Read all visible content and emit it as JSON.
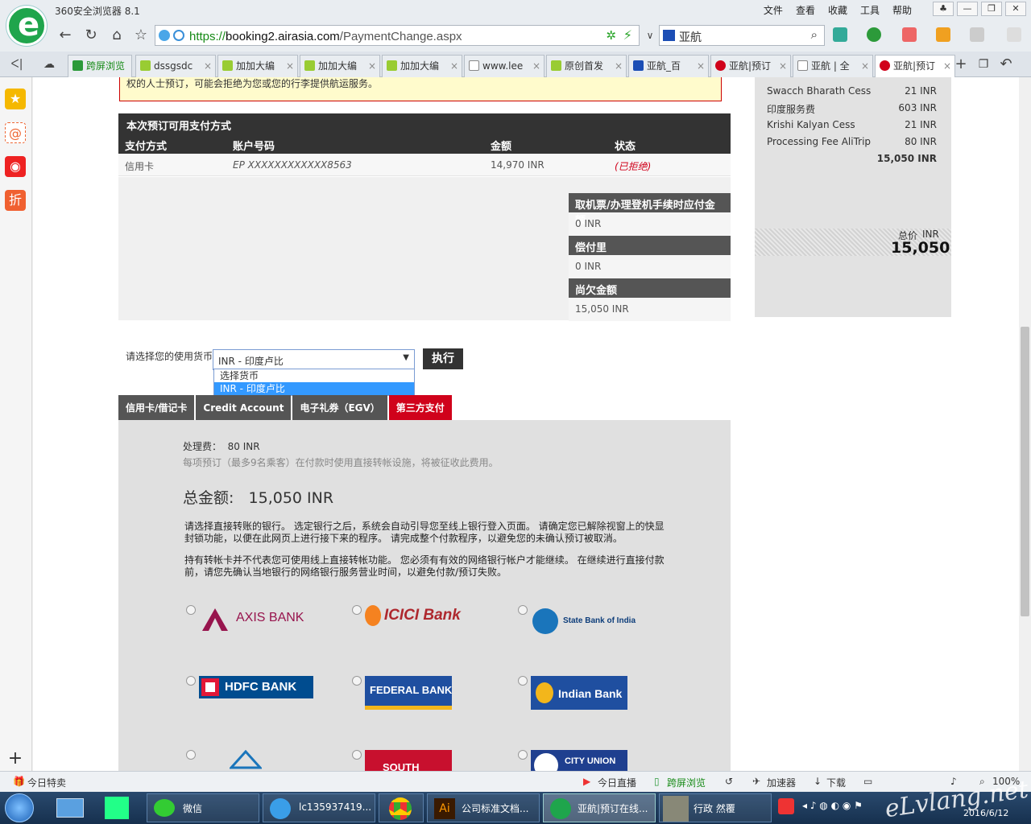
{
  "browser": {
    "app_title": "360安全浏览器 8.1",
    "menu": [
      "文件",
      "查看",
      "收藏",
      "工具",
      "帮助"
    ],
    "url_scheme": "https://",
    "url_host": "booking2.airasia.com",
    "url_path": "/PaymentChange.aspx",
    "search_text": "亚航",
    "tabs": [
      "跨屏浏览",
      "dssgsdc",
      "加加大编",
      "加加大编",
      "加加大编",
      "www.lee",
      "原创首发",
      "亚航_百",
      "亚航|预订",
      "亚航 | 全",
      "亚航|预订"
    ]
  },
  "notice": {
    "text": "权的人士预订，可能会拒绝为您或您的行李提供航运服务。"
  },
  "payments": {
    "title": "本次预订可用支付方式",
    "headers": [
      "支付方式",
      "账户号码",
      "金额",
      "状态"
    ],
    "rows": [
      {
        "method": "信用卡",
        "account": "EP XXXXXXXXXXXX8563",
        "amount": "14,970 INR",
        "status": "(已拒绝)"
      }
    ]
  },
  "summary": [
    {
      "title": "取机票/办理登机手续时应付金额",
      "value": "0 INR"
    },
    {
      "title": "偿付里",
      "value": "0 INR"
    },
    {
      "title": "尚欠金额",
      "value": "15,050 INR"
    }
  ],
  "fare_panel": {
    "rows": [
      {
        "label": "Swacch Bharath Cess",
        "amount": "21 INR"
      },
      {
        "label": "印度服务费",
        "amount": "603 INR"
      },
      {
        "label": "Krishi Kalyan Cess",
        "amount": "21 INR"
      },
      {
        "label": "Processing Fee AliTrip",
        "amount": "80 INR"
      }
    ],
    "subtotal": "15,050 INR",
    "total_label": "总价",
    "total_currency": "INR",
    "total_value": "15,050"
  },
  "currency": {
    "label": "请选择您的使用货币",
    "selected": "INR - 印度卢比",
    "options": [
      "选择货币",
      "INR - 印度卢比"
    ],
    "button": "执行"
  },
  "payment_tabs": [
    "信用卡/借记卡",
    "Credit Account",
    "电子礼券（EGV）",
    "第三方支付"
  ],
  "direct_debit": {
    "fee_label": "处理费：",
    "fee_value": "80 INR",
    "fee_note": "每项预订（最多9名乘客）在付款时使用直接转帐设施，将被征收此费用。",
    "total_label": "总金额:",
    "total_value": "15,050 INR",
    "para1": "请选择直接转账的银行。 选定银行之后，系统会自动引导您至线上银行登入页面。 请确定您已解除视窗上的快显封锁功能，以便在此网页上进行接下来的程序。 请完成整个付款程序，以避免您的未确认预订被取消。",
    "para2": "持有转帐卡并不代表您可使用线上直接转帐功能。 您必须有有效的网络银行帐户才能继续。 在继续进行直接付款前，请您先确认当地银行的网络银行服务营业时间，以避免付款/预订失败。",
    "banks": [
      "AXIS BANK",
      "ICICI Bank",
      "State Bank of India",
      "HDFC BANK",
      "FEDERAL BANK",
      "Indian Bank",
      "",
      "SOUTH",
      "CITY UNION"
    ]
  },
  "statusbar": {
    "left": "今日特卖",
    "live": "今日直播",
    "cross": "跨屏浏览",
    "accel": "加速器",
    "download": "下载",
    "zoom": "100%"
  },
  "taskbar": {
    "items": [
      "微信",
      "lc135937419...",
      "",
      "公司标准文档...",
      "亚航|预订在线...",
      "行政 然覆"
    ],
    "date": "2016/6/12"
  },
  "watermark": "eLvlang.net",
  "colors": {
    "accent_red": "#d0021b",
    "header_dark": "#333333",
    "tab_dark": "#555555",
    "url_green": "#168a16"
  }
}
